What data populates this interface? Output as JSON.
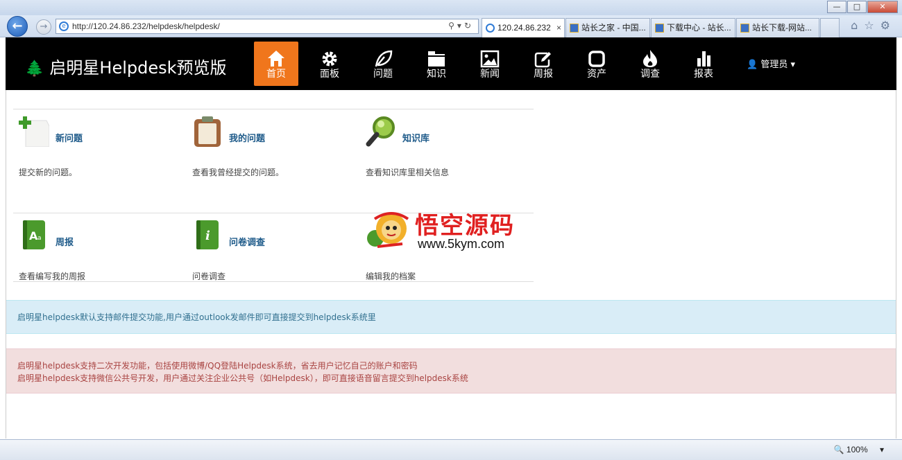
{
  "browser": {
    "url": "http://120.24.86.232/helpdesk/helpdesk/",
    "tabs": [
      {
        "label": "120.24.86.232"
      },
      {
        "label": "站长之家 - 中国..."
      },
      {
        "label": "下载中心 - 站长..."
      },
      {
        "label": "站长下载-网站..."
      }
    ],
    "zoom": "100%",
    "window_buttons": {
      "min": "—",
      "max": "□",
      "close": "✕"
    }
  },
  "app": {
    "brand": "启明星Helpdesk预览版",
    "nav": [
      {
        "label": "首页",
        "icon": "home-icon"
      },
      {
        "label": "面板",
        "icon": "gear-icon"
      },
      {
        "label": "问题",
        "icon": "leaf-icon"
      },
      {
        "label": "知识",
        "icon": "folder-icon"
      },
      {
        "label": "新闻",
        "icon": "image-icon"
      },
      {
        "label": "周报",
        "icon": "edit-icon"
      },
      {
        "label": "资产",
        "icon": "square-icon"
      },
      {
        "label": "调查",
        "icon": "fire-icon"
      },
      {
        "label": "报表",
        "icon": "bar-chart-icon"
      }
    ],
    "user": "管理员"
  },
  "tiles": [
    {
      "title": "新问题",
      "desc": "提交新的问题。",
      "icon": "new-issue-icon"
    },
    {
      "title": "我的问题",
      "desc": "查看我曾经提交的问题。",
      "icon": "clipboard-icon"
    },
    {
      "title": "知识库",
      "desc": "查看知识库里相关信息",
      "icon": "magnifier-icon"
    },
    {
      "title": "周报",
      "desc": "查看编写我的周报",
      "icon": "book-icon"
    },
    {
      "title": "问卷调查",
      "desc": "问卷调查",
      "icon": "info-book-icon"
    },
    {
      "title": "",
      "desc": "编辑我的档案",
      "icon": "profile-icon"
    }
  ],
  "alerts": {
    "info": "启明星helpdesk默认支持邮件提交功能,用户通过outlook发邮件即可直接提交到helpdesk系统里",
    "danger": [
      "启明星helpdesk支持二次开发功能，包括使用微博/QQ登陆Helpdesk系统，省去用户记忆自己的账户和密码",
      "启明星helpdesk支持微信公共号开发，用户通过关注企业公共号（如Helpdesk），即可直接语音留言提交到helpdesk系统"
    ]
  },
  "watermark": {
    "title": "悟空源码",
    "url": "www.5kym.com"
  }
}
